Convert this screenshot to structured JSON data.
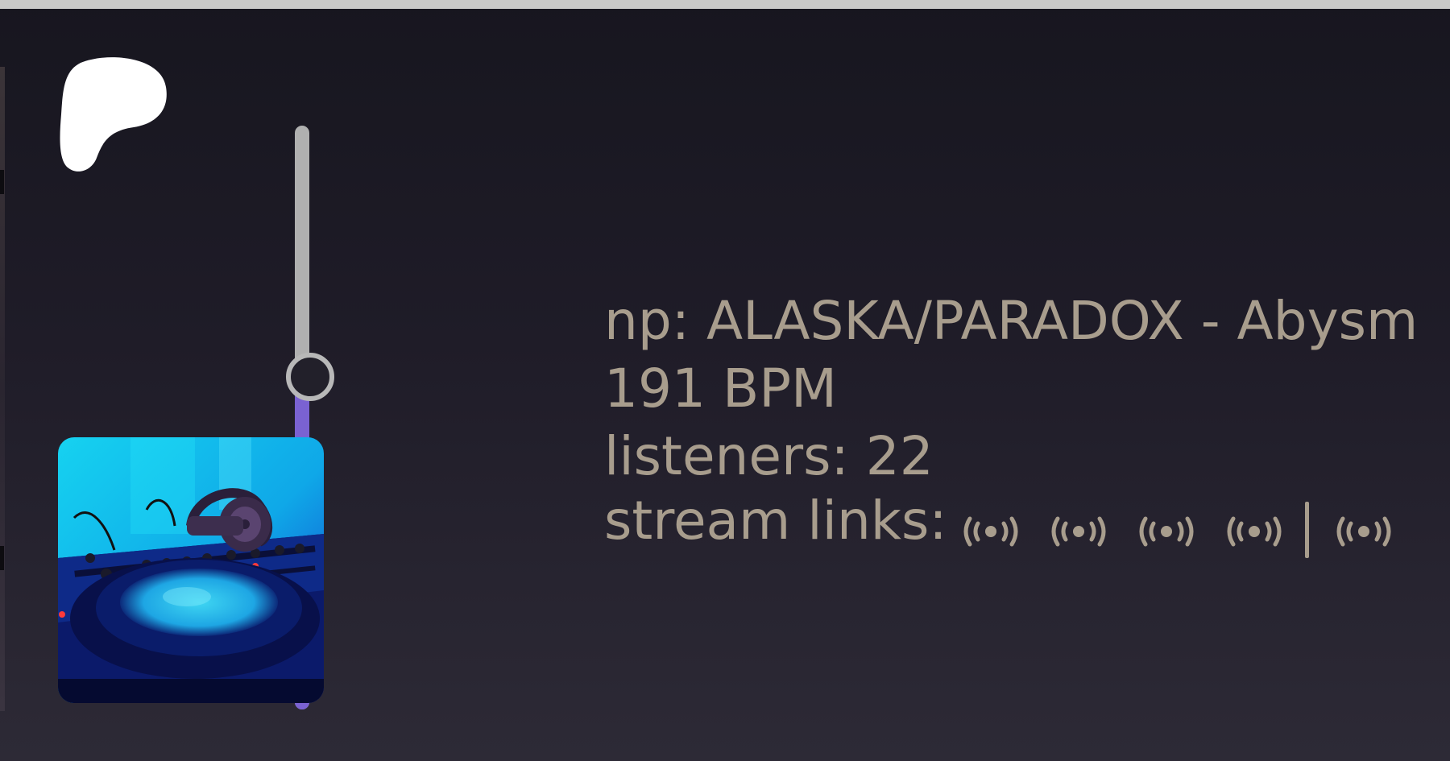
{
  "colors": {
    "background_top": "#17161f",
    "background_bottom": "#2d2a36",
    "text": "#a89d8d",
    "slider_track": "#b0b0b0",
    "slider_fill": "#7a62d2",
    "top_bar": "#c8c8c8"
  },
  "patreon": {
    "icon": "patreon-icon"
  },
  "volume": {
    "level": 0.57
  },
  "album_art": {
    "icon": "album-art-dj-deck"
  },
  "now_playing": {
    "track": "np: ALASKA/PARADOX - Abysm",
    "bpm": "191 BPM",
    "listeners": "listeners: 22",
    "stream_links_label": "stream links:"
  },
  "stream_links": [
    {
      "icon": "broadcast-icon"
    },
    {
      "icon": "broadcast-icon"
    },
    {
      "icon": "broadcast-icon"
    },
    {
      "icon": "broadcast-icon"
    },
    {
      "icon": "broadcast-icon"
    }
  ]
}
